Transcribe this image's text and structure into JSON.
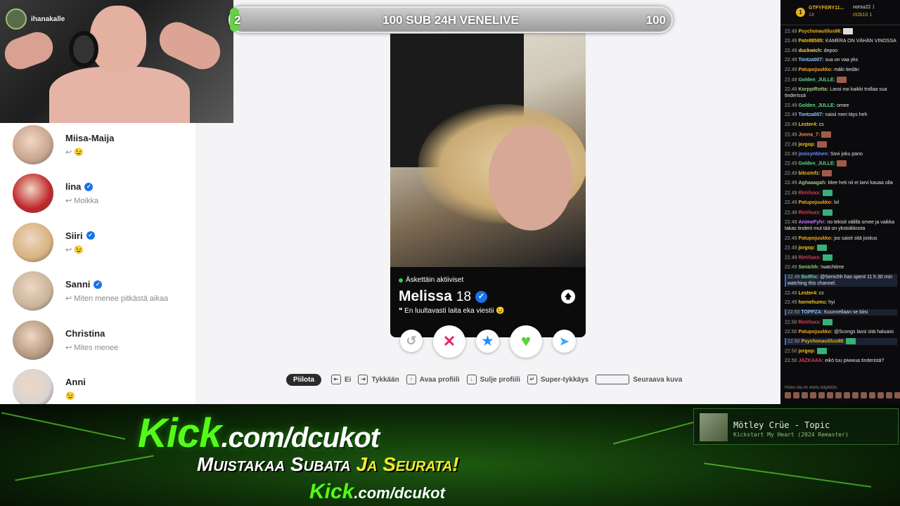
{
  "streamer": {
    "name": "ihanakalle"
  },
  "goal": {
    "left": "2",
    "title": "100 SUB 24H VENELIVE",
    "right": "100",
    "progress": 0.02
  },
  "matches": [
    {
      "name": "Miisa-Maija",
      "verified": false,
      "preview": "↩ 😉",
      "color": "#c8a48e"
    },
    {
      "name": "lina",
      "verified": true,
      "preview": "↩ Moikka",
      "color": "#c0262a"
    },
    {
      "name": "Siiri",
      "verified": true,
      "preview": "↩ 😉",
      "color": "#d6b27e"
    },
    {
      "name": "Sanni",
      "verified": true,
      "preview": "↩ Miten menee pitkästä aikaa",
      "color": "#c9b49a"
    },
    {
      "name": "Christina",
      "verified": false,
      "preview": "↩ Mites menee",
      "color": "#b59a80"
    },
    {
      "name": "Anni",
      "verified": false,
      "preview": "😉",
      "color": "#d9d4d2"
    }
  ],
  "profile": {
    "active_label": "Äskettäin aktiiviset",
    "name": "Melissa",
    "age": "18",
    "bio": "❝ En luultavasti laita eka viestii 😉",
    "up_icon": "🡅"
  },
  "actions": {
    "rewind_icon": "↺",
    "nope_icon": "✕",
    "superlike_icon": "★",
    "like_icon": "♥",
    "boost_icon": "➤"
  },
  "shortcuts": {
    "hide": "Piilota",
    "no": "Ei",
    "like": "Tykkään",
    "open": "Avaa profiili",
    "close": "Sulje profiili",
    "super": "Super-tykkäys",
    "next": "Seuraava kuva"
  },
  "chat": {
    "gifter": "GTFYFERY11...",
    "gifter_count": "14",
    "top1": "norsu22",
    "top1_count": "1",
    "top2": "r02k10",
    "top2_count": "1",
    "messages": [
      {
        "t": "22.49",
        "u": "Psychonautilus98:",
        "c": "#e9b31c",
        "m": "",
        "e": "w",
        "hl": false
      },
      {
        "t": "22.49",
        "u": "Pate88585:",
        "c": "#f5c518",
        "m": "KAMERA ON VÄHÄN VINOSSA",
        "e": "",
        "hl": false
      },
      {
        "t": "22.49",
        "u": "duckwich:",
        "c": "#f7d26b",
        "m": "depoo",
        "e": "",
        "hl": false
      },
      {
        "t": "22.49",
        "u": "Tontza007:",
        "c": "#8ec6ff",
        "m": "sua on vaa yks",
        "e": "",
        "hl": false
      },
      {
        "t": "22.49",
        "u": "Patupojuukko:",
        "c": "#f5a623",
        "m": "mäki tiedän",
        "e": "",
        "hl": false
      },
      {
        "t": "22.49",
        "u": "Golden_JULLE:",
        "c": "#5ddc8a",
        "m": "",
        "e": "r",
        "hl": false
      },
      {
        "t": "22.49",
        "u": "KorppiRotta:",
        "c": "#9bd07a",
        "m": "Lassi noi kaikki trollaa sua tinderissä",
        "e": "",
        "hl": false
      },
      {
        "t": "22.49",
        "u": "Golden_JULLE:",
        "c": "#5ddc8a",
        "m": "omee",
        "e": "",
        "hl": false
      },
      {
        "t": "22.49",
        "u": "Tontza007:",
        "c": "#8ec6ff",
        "m": "naisii meri täys heh",
        "e": "",
        "hl": false
      },
      {
        "t": "22.49",
        "u": "Lester4:",
        "c": "#f5c518",
        "m": "cs",
        "e": "",
        "hl": false
      },
      {
        "t": "22.49",
        "u": "Joona_7:",
        "c": "#f08a4b",
        "m": "",
        "e": "r",
        "hl": false
      },
      {
        "t": "22.49",
        "u": "jorgop:",
        "c": "#f5c518",
        "m": "",
        "e": "r",
        "hl": false
      },
      {
        "t": "22.49",
        "u": "jonisyntinen:",
        "c": "#6e8bff",
        "m": "Sovi joku pano",
        "e": "",
        "hl": false
      },
      {
        "t": "22.49",
        "u": "Golden_JULLE:",
        "c": "#5ddc8a",
        "m": "",
        "e": "r",
        "hl": false
      },
      {
        "t": "22.49",
        "u": "bitcoinfz:",
        "c": "#f5c518",
        "m": "",
        "e": "r",
        "hl": false
      },
      {
        "t": "22.49",
        "u": "Aghaaagah:",
        "c": "#9bd07a",
        "m": "Mee heti nii ei tarvi kauaa olla",
        "e": "",
        "hl": false
      },
      {
        "t": "22.49",
        "u": "RinViuxx:",
        "c": "#e0405a",
        "m": "",
        "e": "g",
        "hl": false
      },
      {
        "t": "22.49",
        "u": "Patupojuukko:",
        "c": "#f5a623",
        "m": "lol",
        "e": "",
        "hl": false
      },
      {
        "t": "22.49",
        "u": "RinViuxx:",
        "c": "#e0405a",
        "m": "",
        "e": "g",
        "hl": false
      },
      {
        "t": "22.49",
        "u": "AnimeFyhr:",
        "c": "#c678ff",
        "m": "no tekisit välillä omee ja vaikka takas tinderii mut tää on ykstoikkosta",
        "e": "",
        "hl": false
      },
      {
        "t": "22.49",
        "u": "Patupojuukko:",
        "c": "#f5a623",
        "m": "jos saisit sitä joskus",
        "e": "",
        "hl": false
      },
      {
        "t": "22.49",
        "u": "jorgop:",
        "c": "#f5c518",
        "m": "",
        "e": "g",
        "hl": false
      },
      {
        "t": "22.49",
        "u": "RinViuxx:",
        "c": "#e0405a",
        "m": "",
        "e": "g",
        "hl": false
      },
      {
        "t": "22.49",
        "u": "Senichh:",
        "c": "#9bd07a",
        "m": "!watchtime",
        "e": "",
        "hl": false
      },
      {
        "t": "22.49",
        "u": "BotRix:",
        "c": "#5ddc8a",
        "m": "@Senichh has spent 11 h 30 min watching this channel.",
        "e": "",
        "hl": true
      },
      {
        "t": "22.49",
        "u": "Lester4:",
        "c": "#f5c518",
        "m": "cs",
        "e": "",
        "hl": false
      },
      {
        "t": "22.49",
        "u": "hornehumu:",
        "c": "#f5c518",
        "m": "hyi",
        "e": "",
        "hl": false
      },
      {
        "t": "22.50",
        "u": "TOPPZA:",
        "c": "#8ec6ff",
        "m": "Kuunnellaan se biisi",
        "e": "",
        "hl": true
      },
      {
        "t": "22.50",
        "u": "RinViuxx:",
        "c": "#e0405a",
        "m": "",
        "e": "g",
        "hl": false
      },
      {
        "t": "22.50",
        "u": "Patupojuukko:",
        "c": "#f5a623",
        "m": "@Scongs lassi sitä haluaisi",
        "e": "",
        "hl": false
      },
      {
        "t": "22.50",
        "u": "Psychonautilus98:",
        "c": "#e9b31c",
        "m": "",
        "e": "g",
        "hl": true
      },
      {
        "t": "22.50",
        "u": "jorgop:",
        "c": "#f5c518",
        "m": "",
        "e": "g",
        "hl": false
      },
      {
        "t": "22.50",
        "u": "JAZKAAA:",
        "c": "#e0405a",
        "m": "eikö tuu piwwua tinderistä?",
        "e": "",
        "hl": false
      }
    ],
    "footer": "Hides tila on otettu käyttöön."
  },
  "banner": {
    "kick1_main": "Kick",
    "kick1_rest": ".com/dcukot",
    "line2a": "Muistakaa Subata ",
    "line2b": "Ja Seurata!",
    "kick2_main": "Kick",
    "kick2_rest": ".com/dcukot"
  },
  "music": {
    "title": "Mötley Crüe - Topic",
    "track": "Kickstart My Heart (2024 Remaster)"
  }
}
